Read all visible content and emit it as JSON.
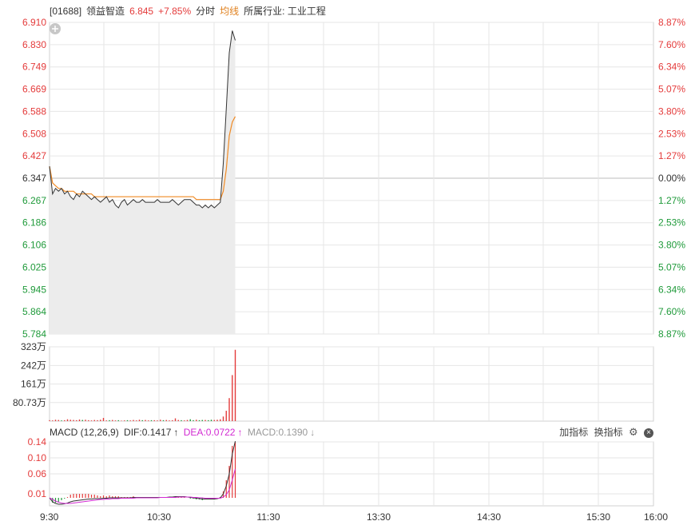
{
  "header": {
    "code": "[01688]",
    "name": "领益智造",
    "price": "6.845",
    "change": "+7.85%",
    "mode": "分时",
    "avg_label": "均线",
    "industry": "所属行业: 工业工程"
  },
  "macd_bar": {
    "title": "MACD (12,26,9)",
    "dif": "DIF:0.1417",
    "dif_arrow": "↑",
    "dea": "DEA:0.0722",
    "dea_arrow": "↑",
    "macd": "MACD:0.1390",
    "macd_arrow": "↓",
    "add_indicator": "加指标",
    "switch_indicator": "换指标"
  },
  "colors": {
    "up": "#e43b3b",
    "down": "#1f9a3a",
    "price_line": "#333333",
    "avg_line": "#f08a24",
    "dif_line": "#333333",
    "dea_line": "#d22ad2"
  },
  "chart_data": [
    {
      "type": "line",
      "panel": "price",
      "y_left_ticks": [
        "6.910",
        "6.830",
        "6.749",
        "6.669",
        "6.588",
        "6.508",
        "6.427",
        "6.347",
        "6.267",
        "6.186",
        "6.106",
        "6.025",
        "5.945",
        "5.864",
        "5.784"
      ],
      "y_right_ticks": [
        "8.87%",
        "7.60%",
        "6.34%",
        "5.07%",
        "3.80%",
        "2.53%",
        "1.27%",
        "0.00%",
        "1.27%",
        "2.53%",
        "3.80%",
        "5.07%",
        "6.34%",
        "7.60%",
        "8.87%"
      ],
      "ylim": [
        5.784,
        6.91
      ],
      "prev_close": 6.347,
      "x_ticks": [
        "9:30",
        "10:30",
        "11:30",
        "13:30",
        "14:30",
        "15:30",
        "16:00"
      ],
      "series": [
        {
          "role": "price",
          "values": [
            6.39,
            6.29,
            6.31,
            6.3,
            6.31,
            6.29,
            6.3,
            6.28,
            6.27,
            6.29,
            6.28,
            6.3,
            6.29,
            6.28,
            6.27,
            6.28,
            6.27,
            6.26,
            6.27,
            6.28,
            6.26,
            6.27,
            6.25,
            6.24,
            6.26,
            6.27,
            6.25,
            6.26,
            6.27,
            6.26,
            6.26,
            6.27,
            6.26,
            6.26,
            6.26,
            6.26,
            6.27,
            6.26,
            6.26,
            6.26,
            6.26,
            6.27,
            6.26,
            6.25,
            6.26,
            6.27,
            6.27,
            6.27,
            6.26,
            6.25,
            6.25,
            6.24,
            6.25,
            6.24,
            6.25,
            6.24,
            6.25,
            6.26,
            6.4,
            6.6,
            6.8,
            6.88,
            6.845
          ]
        },
        {
          "role": "average",
          "values": [
            6.39,
            6.33,
            6.32,
            6.31,
            6.31,
            6.3,
            6.3,
            6.3,
            6.3,
            6.29,
            6.29,
            6.29,
            6.29,
            6.29,
            6.29,
            6.28,
            6.28,
            6.28,
            6.28,
            6.28,
            6.28,
            6.28,
            6.28,
            6.28,
            6.28,
            6.28,
            6.28,
            6.28,
            6.28,
            6.28,
            6.28,
            6.28,
            6.28,
            6.28,
            6.28,
            6.28,
            6.28,
            6.28,
            6.28,
            6.28,
            6.28,
            6.28,
            6.28,
            6.28,
            6.28,
            6.28,
            6.28,
            6.28,
            6.28,
            6.27,
            6.27,
            6.27,
            6.27,
            6.27,
            6.27,
            6.27,
            6.27,
            6.27,
            6.3,
            6.38,
            6.5,
            6.55,
            6.57
          ]
        }
      ]
    },
    {
      "type": "bar",
      "panel": "volume",
      "y_ticks": [
        "323万",
        "242万",
        "161万",
        "80.73万"
      ],
      "ylim": [
        0,
        323
      ],
      "unit": "万",
      "values": [
        4,
        3,
        6,
        5,
        3,
        4,
        8,
        6,
        5,
        4,
        7,
        5,
        6,
        4,
        3,
        5,
        4,
        6,
        14,
        3,
        4,
        5,
        3,
        4,
        2,
        3,
        4,
        3,
        5,
        3,
        6,
        4,
        5,
        3,
        4,
        4,
        3,
        6,
        4,
        5,
        3,
        4,
        12,
        5,
        4,
        3,
        5,
        8,
        4,
        6,
        4,
        5,
        5,
        4,
        6,
        5,
        6,
        8,
        20,
        45,
        100,
        200,
        310
      ],
      "up": [
        1,
        1,
        1,
        1,
        0,
        1,
        1,
        1,
        1,
        1,
        1,
        0,
        1,
        1,
        1,
        1,
        1,
        1,
        1,
        1,
        0,
        1,
        1,
        0,
        1,
        1,
        0,
        1,
        1,
        1,
        1,
        0,
        1,
        1,
        0,
        1,
        1,
        1,
        0,
        1,
        1,
        1,
        1,
        1,
        0,
        1,
        1,
        0,
        0,
        1,
        0,
        0,
        1,
        0,
        0,
        1,
        1,
        1,
        1,
        1,
        1,
        1,
        1
      ]
    },
    {
      "type": "line",
      "panel": "macd",
      "y_ticks": [
        "0.14",
        "0.10",
        "0.06",
        "0.01"
      ],
      "ylim": [
        -0.02,
        0.14
      ],
      "series": [
        {
          "role": "DIF",
          "values": [
            0.0,
            -0.01,
            -0.014,
            -0.016,
            -0.016,
            -0.015,
            -0.013,
            -0.01,
            -0.008,
            -0.007,
            -0.006,
            -0.005,
            -0.004,
            -0.003,
            -0.003,
            -0.002,
            -0.002,
            -0.002,
            -0.001,
            -0.001,
            0.0,
            0.0,
            0.0,
            0.0,
            0.0,
            0.0,
            0.0,
            0.0,
            0.001,
            0.001,
            0.001,
            0.001,
            0.001,
            0.001,
            0.001,
            0.001,
            0.001,
            0.001,
            0.001,
            0.001,
            0.002,
            0.002,
            0.003,
            0.003,
            0.003,
            0.003,
            0.002,
            0.001,
            0.0,
            -0.001,
            -0.002,
            -0.003,
            -0.003,
            -0.003,
            -0.003,
            -0.003,
            -0.002,
            0.0,
            0.01,
            0.03,
            0.06,
            0.11,
            0.1417
          ]
        },
        {
          "role": "DEA",
          "values": [
            0.0,
            -0.004,
            -0.008,
            -0.011,
            -0.013,
            -0.014,
            -0.014,
            -0.014,
            -0.013,
            -0.012,
            -0.011,
            -0.01,
            -0.009,
            -0.008,
            -0.007,
            -0.006,
            -0.005,
            -0.004,
            -0.004,
            -0.003,
            -0.003,
            -0.002,
            -0.002,
            -0.002,
            -0.001,
            -0.001,
            -0.001,
            -0.001,
            -0.001,
            0.0,
            0.0,
            0.0,
            0.0,
            0.0,
            0.0,
            0.0,
            0.0,
            0.001,
            0.001,
            0.001,
            0.001,
            0.001,
            0.001,
            0.002,
            0.002,
            0.002,
            0.002,
            0.002,
            0.001,
            0.001,
            0.0,
            0.0,
            -0.001,
            -0.001,
            -0.001,
            -0.001,
            -0.001,
            -0.001,
            0.002,
            0.008,
            0.02,
            0.045,
            0.0722
          ]
        }
      ]
    }
  ]
}
